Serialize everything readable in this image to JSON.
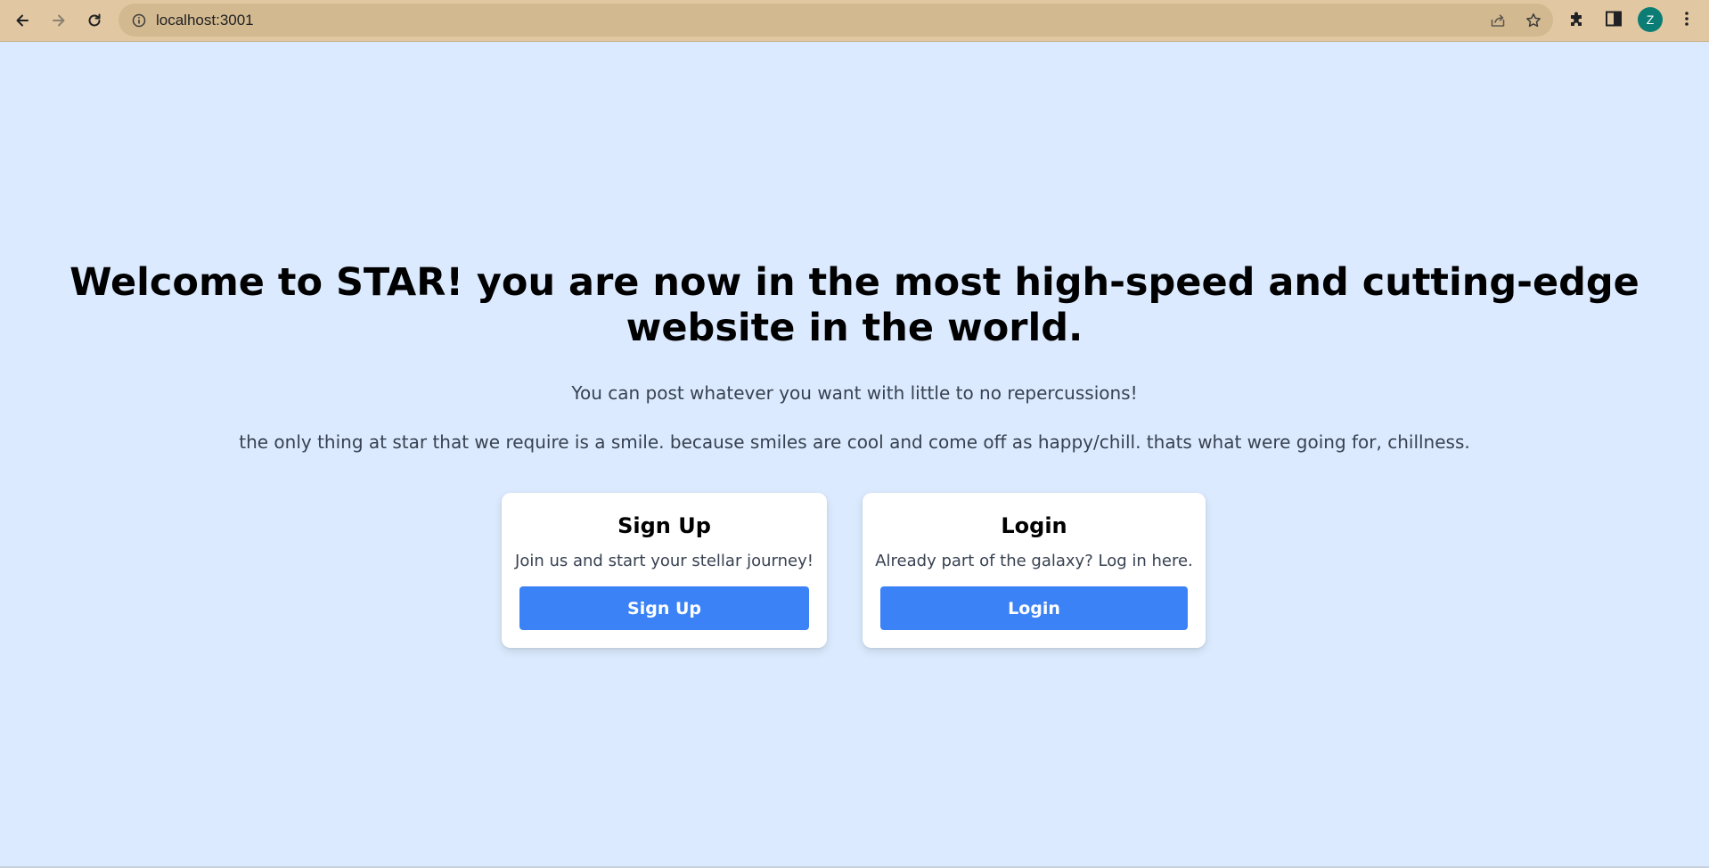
{
  "browser": {
    "url": "localhost:3001",
    "avatar_letter": "Z",
    "icons": [
      "back-arrow-icon",
      "forward-arrow-icon",
      "reload-icon",
      "info-icon",
      "share-icon",
      "star-icon",
      "extensions-puzzle-icon",
      "side-panel-icon",
      "kebab-menu-icon"
    ]
  },
  "hero": {
    "title": "Welcome to STAR! you are now in the most high-speed and cutting-edge website in the world.",
    "subtitle_1": "You can post whatever you want with little to no repercussions!",
    "subtitle_2": "the only thing at star that we require is a smile. because smiles are cool and come off as happy/chill. thats what were going for, chillness."
  },
  "cards": {
    "signup": {
      "title": "Sign Up",
      "description": "Join us and start your stellar journey!",
      "button_label": "Sign Up"
    },
    "login": {
      "title": "Login",
      "description": "Already part of the galaxy? Log in here.",
      "button_label": "Login"
    }
  },
  "colors": {
    "page_background": "#dbeafe",
    "browser_chrome": "#e2c8a2",
    "primary_button": "#3b82f6",
    "avatar": "#0b7d74"
  }
}
